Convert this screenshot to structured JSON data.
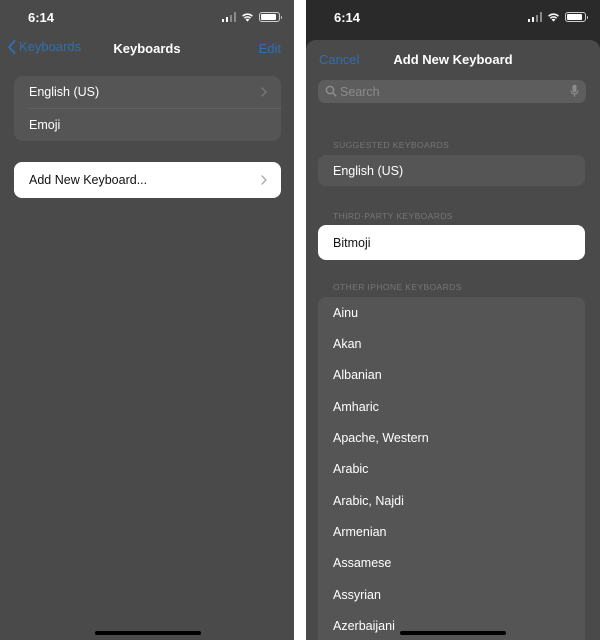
{
  "colors": {
    "link_blue": "#2f6fb0",
    "dim_background": "#4a4a4a",
    "highlight": "#ffffff"
  },
  "left_phone": {
    "status": {
      "time": "6:14",
      "battery_level": 0.8
    },
    "nav": {
      "back_label": "Keyboards",
      "title": "Keyboards",
      "edit_label": "Edit"
    },
    "keyboards": [
      {
        "label": "English (US)",
        "icon": "chevron-right-icon"
      },
      {
        "label": "Emoji"
      }
    ],
    "add_new_label": "Add New Keyboard..."
  },
  "right_phone": {
    "status": {
      "time": "6:14",
      "battery_level": 0.8
    },
    "sheet": {
      "cancel_label": "Cancel",
      "title": "Add New Keyboard"
    },
    "search": {
      "placeholder": "Search",
      "value": ""
    },
    "suggested": {
      "header": "SUGGESTED KEYBOARDS",
      "items": [
        "English (US)"
      ]
    },
    "third_party": {
      "header": "THIRD-PARTY KEYBOARDS",
      "items": [
        "Bitmoji"
      ]
    },
    "other": {
      "header": "OTHER IPHONE KEYBOARDS",
      "items": [
        "Ainu",
        "Akan",
        "Albanian",
        "Amharic",
        "Apache, Western",
        "Arabic",
        "Arabic, Najdi",
        "Armenian",
        "Assamese",
        "Assyrian",
        "Azerbaijani"
      ]
    }
  }
}
